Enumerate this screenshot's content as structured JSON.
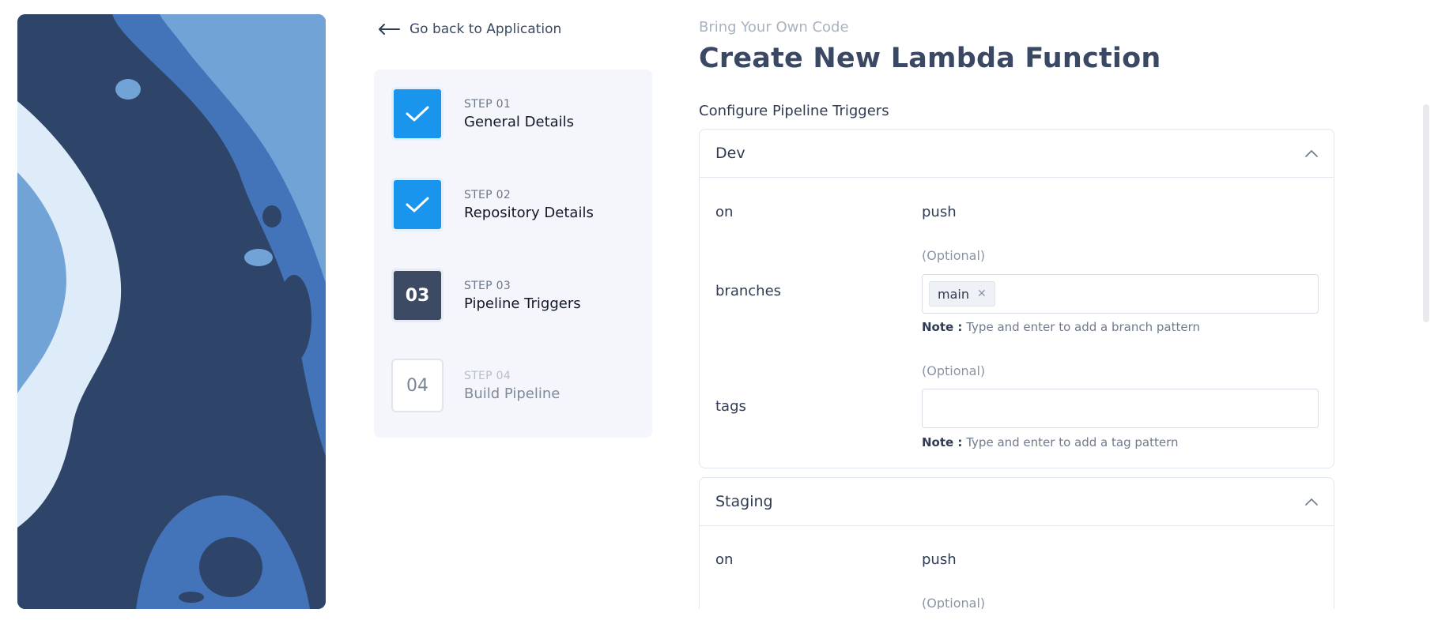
{
  "nav": {
    "back_label": "Go back to Application"
  },
  "stepper": {
    "steps": [
      {
        "number": "STEP 01",
        "title": "General Details",
        "status": "done",
        "box": ""
      },
      {
        "number": "STEP 02",
        "title": "Repository Details",
        "status": "done",
        "box": ""
      },
      {
        "number": "STEP 03",
        "title": "Pipeline Triggers",
        "status": "current",
        "box": "03"
      },
      {
        "number": "STEP 04",
        "title": "Build Pipeline",
        "status": "pending",
        "box": "04"
      }
    ]
  },
  "header": {
    "eyebrow": "Bring Your Own Code",
    "title": "Create New Lambda Function",
    "section": "Configure Pipeline Triggers"
  },
  "panels": {
    "dev": {
      "title": "Dev",
      "on_label": "on",
      "on_value": "push",
      "branches_label": "branches",
      "branches_optional": "(Optional)",
      "branches_chips": [
        "main"
      ],
      "branches_note_label": "Note :",
      "branches_note": "Type and enter to add a branch pattern",
      "tags_label": "tags",
      "tags_optional": "(Optional)",
      "tags_note_label": "Note :",
      "tags_note": "Type and enter to add a tag pattern"
    },
    "staging": {
      "title": "Staging",
      "on_label": "on",
      "on_value": "push",
      "branches_optional": "(Optional)"
    }
  },
  "colors": {
    "accent": "#1a95ee",
    "current_step": "#3d4a64",
    "art_dark": "#2e4468",
    "art_mid": "#4373b8",
    "art_light": "#72a3d6",
    "art_pale": "#deebf9"
  }
}
